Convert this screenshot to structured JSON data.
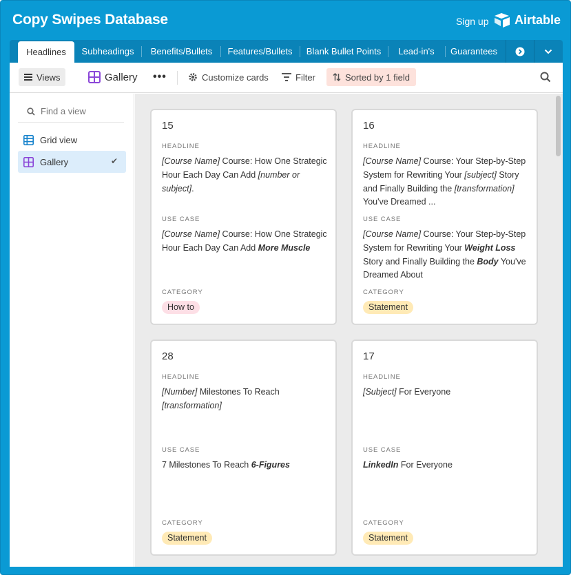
{
  "app": {
    "title": "Copy Swipes Database",
    "signup_label": "Sign up",
    "brand_name": "Airtable"
  },
  "tabs": [
    {
      "label": "Headlines",
      "active": true
    },
    {
      "label": "Subheadings",
      "active": false
    },
    {
      "label": "Benefits/Bullets",
      "active": false
    },
    {
      "label": "Features/Bullets",
      "active": false
    },
    {
      "label": "Blank Bullet Points",
      "active": false
    },
    {
      "label": "Lead-in's",
      "active": false
    },
    {
      "label": "Guarantees",
      "active": false
    }
  ],
  "tab_icons": {
    "more_tables": "circle-arrow-right-icon",
    "menu": "chevron-down-icon"
  },
  "toolbar": {
    "views_label": "Views",
    "view_name": "Gallery",
    "more_label": "•••",
    "customize_label": "Customize cards",
    "filter_label": "Filter",
    "sort_label": "Sorted by 1 field"
  },
  "sidebar": {
    "find_placeholder": "Find a view",
    "items": [
      {
        "label": "Grid view",
        "icon": "grid-icon",
        "selected": false
      },
      {
        "label": "Gallery",
        "icon": "gallery-icon",
        "selected": true
      }
    ]
  },
  "fields": {
    "headline": "HEADLINE",
    "use_case": "USE CASE",
    "category": "CATEGORY"
  },
  "cards": [
    {
      "number": "15",
      "headline": [
        [
          "i",
          "[Course Name]"
        ],
        [
          "t",
          " Course: How One Strategic Hour Each Day Can Add "
        ],
        [
          "i",
          "[number or subject]"
        ],
        [
          "t",
          "."
        ]
      ],
      "use_case": [
        [
          "i",
          "[Course Name]"
        ],
        [
          "t",
          " Course: How One Strategic Hour Each Day Can Add "
        ],
        [
          "bi",
          "More Muscle"
        ]
      ],
      "category": "How to",
      "category_color": "#fddfe6"
    },
    {
      "number": "16",
      "headline": [
        [
          "i",
          "[Course Name]"
        ],
        [
          "t",
          " Course: Your Step-by-Step System for Rewriting Your "
        ],
        [
          "i",
          "[subject]"
        ],
        [
          "t",
          " Story and Finally Building the "
        ],
        [
          "i",
          "[transformation]"
        ],
        [
          "t",
          " You've Dreamed ..."
        ]
      ],
      "use_case": [
        [
          "i",
          "[Course Name]"
        ],
        [
          "t",
          " Course: Your Step-by-Step System for Rewriting Your "
        ],
        [
          "bi",
          "Weight Loss"
        ],
        [
          "t",
          " Story and Finally Building the "
        ],
        [
          "bi",
          "Body"
        ],
        [
          "t",
          " You've Dreamed About"
        ]
      ],
      "category": "Statement",
      "category_color": "#ffeab6"
    },
    {
      "number": "28",
      "headline": [
        [
          "i",
          "[Number]"
        ],
        [
          "t",
          " Milestones To Reach "
        ],
        [
          "i",
          "[transformation]"
        ]
      ],
      "use_case": [
        [
          "t",
          "7 Milestones To Reach "
        ],
        [
          "bi",
          "6-Figures"
        ]
      ],
      "category": "Statement",
      "category_color": "#ffeab6"
    },
    {
      "number": "17",
      "headline": [
        [
          "i",
          "[Subject]"
        ],
        [
          "t",
          " For Everyone"
        ]
      ],
      "use_case": [
        [
          "bi",
          "LinkedIn"
        ],
        [
          "t",
          " For Everyone"
        ]
      ],
      "category": "Statement",
      "category_color": "#ffeab6"
    }
  ],
  "colors": {
    "frame": "#0a9ad4",
    "tab_strip": "#0a83b8",
    "sort_highlight": "#fde2dc",
    "selected_view": "#dcedfb",
    "gallery_bg": "#ebebeb"
  }
}
